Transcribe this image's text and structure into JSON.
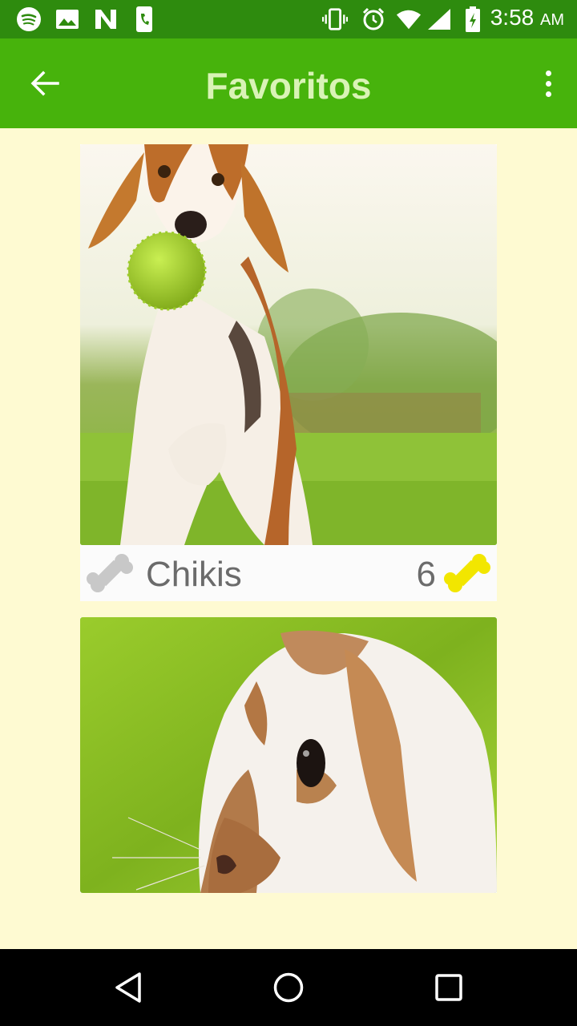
{
  "status_bar": {
    "time": "3:58",
    "ampm": "AM",
    "left_icons": [
      "spotify-icon",
      "image-icon",
      "n-app-icon",
      "phone-app-icon"
    ],
    "right_icons": [
      "vibrate-icon",
      "alarm-icon",
      "wifi-icon",
      "signal-icon",
      "battery-icon"
    ]
  },
  "app_bar": {
    "title": "Favoritos",
    "back_icon": "arrow-back-icon",
    "menu_icon": "more-vert-icon"
  },
  "favorites": [
    {
      "name": "Chikis",
      "likes": "6",
      "photo": "beagle-with-green-ball",
      "liked_icon": "bone-yellow-icon",
      "unliked_icon": "bone-grey-icon"
    },
    {
      "photo": "brown-white-rabbit"
    }
  ],
  "colors": {
    "status_bar": "#2e8b0e",
    "app_bar": "#47b30c",
    "title": "#d9f3b6",
    "background": "#fefad2",
    "bone_grey": "#c8c8c8",
    "bone_yellow": "#f2e600",
    "text": "#6b6b6b"
  },
  "nav_bar": {
    "icons": [
      "nav-back-icon",
      "nav-home-icon",
      "nav-recents-icon"
    ]
  }
}
